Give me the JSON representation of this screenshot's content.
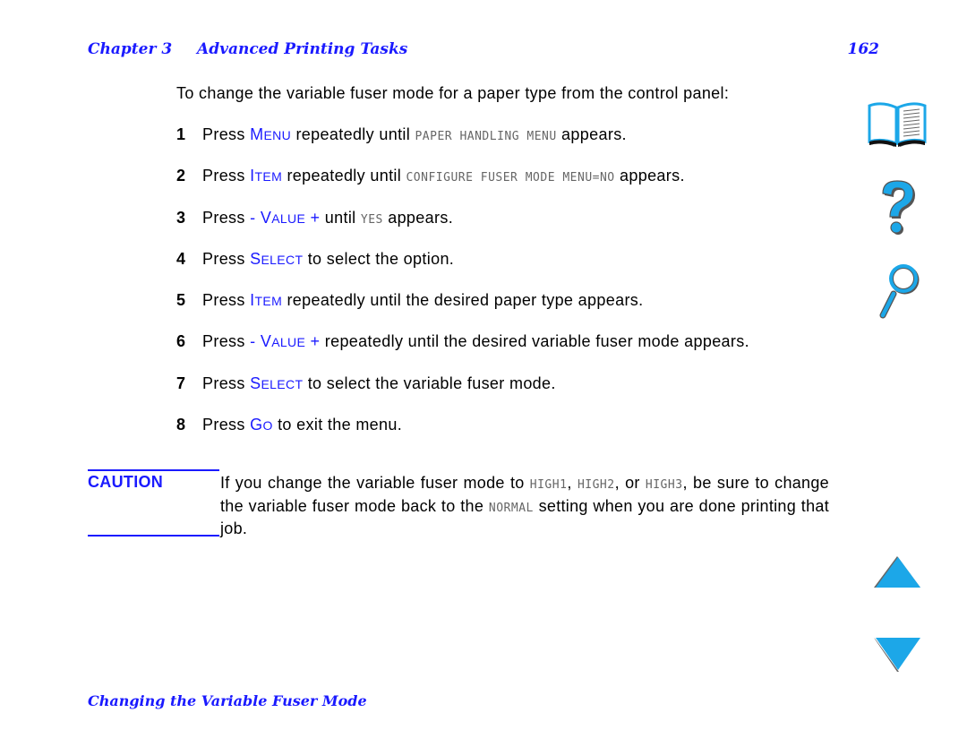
{
  "header": {
    "chapter": "Chapter 3",
    "title": "Advanced Printing Tasks",
    "page_number": "162"
  },
  "intro": "To change the variable fuser mode for a paper type from the control panel:",
  "steps": [
    {
      "num": "1",
      "pre": "Press ",
      "key_first": "M",
      "key_rest": "ENU",
      "mid": " repeatedly until ",
      "lcd": "PAPER HANDLING MENU",
      "post": " appears."
    },
    {
      "num": "2",
      "pre": "Press ",
      "key_first": "I",
      "key_rest": "TEM",
      "mid": " repeatedly until ",
      "lcd": "CONFIGURE FUSER MODE MENU=NO",
      "post": " appears."
    },
    {
      "num": "3",
      "pre": "Press ",
      "key_prefix": "- ",
      "key_first": "V",
      "key_rest": "ALUE",
      "key_suffix": " +",
      "mid": " until ",
      "lcd": "YES",
      "post": " appears."
    },
    {
      "num": "4",
      "pre": "Press ",
      "key_first": "S",
      "key_rest": "ELECT",
      "post": " to select the option."
    },
    {
      "num": "5",
      "pre": "Press ",
      "key_first": "I",
      "key_rest": "TEM",
      "post": " repeatedly until the desired paper type appears."
    },
    {
      "num": "6",
      "pre": "Press ",
      "key_prefix": "- ",
      "key_first": "V",
      "key_rest": "ALUE",
      "key_suffix": " +",
      "post": " repeatedly until the desired variable fuser mode appears."
    },
    {
      "num": "7",
      "pre": "Press ",
      "key_first": "S",
      "key_rest": "ELECT",
      "post": " to select the variable fuser mode."
    },
    {
      "num": "8",
      "pre": "Press ",
      "key_first": "G",
      "key_rest": "O",
      "post": " to exit the menu."
    }
  ],
  "caution": {
    "label": "CAUTION",
    "text_1": "If you change the variable fuser mode to ",
    "lcd_1": "HIGH1",
    "text_2": ", ",
    "lcd_2": "HIGH2",
    "text_3": ", or ",
    "lcd_3": "HIGH3",
    "text_4": ", be sure to change the variable fuser mode back to the ",
    "lcd_4": "NORMAL",
    "text_5": " setting when you are done printing that job."
  },
  "footer": {
    "section_title": "Changing the Variable Fuser Mode"
  },
  "nav_icons": [
    "book-icon",
    "question-icon",
    "magnifier-icon",
    "page-up-icon",
    "page-down-icon"
  ],
  "colors": {
    "accent_blue": "#1a1aff",
    "icon_cyan": "#1ca7e8",
    "lcd_gray": "#666666"
  }
}
